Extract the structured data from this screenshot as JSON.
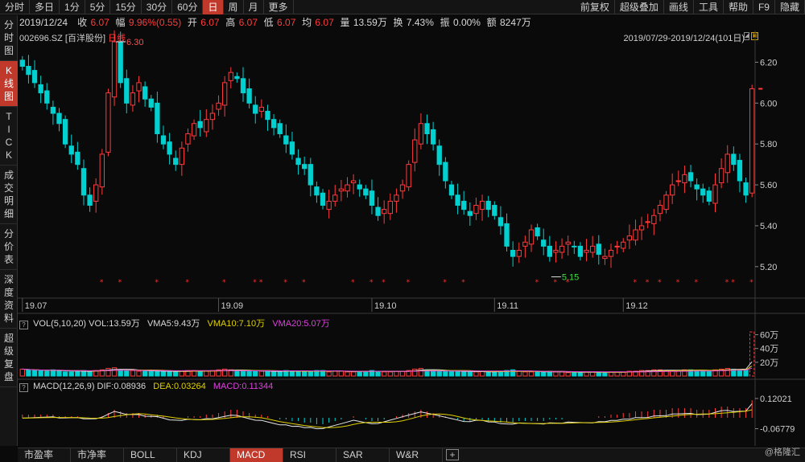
{
  "toolbar": {
    "left": [
      "分时",
      "多日",
      "1分",
      "5分",
      "15分",
      "30分",
      "60分",
      "日",
      "周",
      "月",
      "更多"
    ],
    "active": "日",
    "right": [
      "前复权",
      "超级叠加",
      "画线",
      "工具",
      "帮助",
      "F9",
      "隐藏"
    ]
  },
  "quote": {
    "date": "2019/12/24",
    "close_label": "收",
    "close": "6.07",
    "change_label": "幅",
    "change": "9.96%(0.55)",
    "open_label": "开",
    "open": "6.07",
    "high_label": "高",
    "high": "6.07",
    "low_label": "低",
    "low": "6.07",
    "avg_label": "均",
    "avg": "6.07",
    "volume_label": "量",
    "volume": "13.59万",
    "turnover_label": "换",
    "turnover": "7.43%",
    "amplitude_label": "振",
    "amplitude": "0.00%",
    "amount_label": "额",
    "amount": "8247万"
  },
  "leftnav": [
    "分时图",
    "K线图",
    "TICK",
    "成交明细",
    "分价表",
    "深度资料",
    "超级复盘"
  ],
  "leftnav_active": "K线图",
  "stock": {
    "code": "002696.SZ",
    "name": "[百洋股份]",
    "period": "日线"
  },
  "date_range": "2019/07/29-2019/12/24(101日)",
  "volume_indicator": {
    "name": "VOL(5,10,20)",
    "vol": "VOL:13.59万",
    "vma5": "VMA5:9.43万",
    "vma10": "VMA10:7.10万",
    "vma20": "VMA20:5.07万"
  },
  "macd_indicator": {
    "name": "MACD(12,26,9)",
    "dif": "DIF:0.08936",
    "dea": "DEA:0.03264",
    "macd": "MACD:0.11344"
  },
  "bottom_tabs": [
    "市盈率",
    "市净率",
    "BOLL",
    "KDJ",
    "MACD",
    "RSI",
    "SAR",
    "W&R"
  ],
  "bottom_active": "MACD",
  "watermark": "@格隆汇",
  "colors": {
    "up": "#ff3b3b",
    "down": "#00d0d0",
    "accent": "#c0392b",
    "vma10": "#e0d000",
    "vma20": "#e040e0"
  },
  "chart_data": [
    {
      "type": "candlestick",
      "title": "002696.SZ [百洋股份] 日线",
      "ylim": [
        5.05,
        6.3
      ],
      "y_ticks": [
        "6.20",
        "6.00",
        "5.80",
        "5.60",
        "5.40",
        "5.20"
      ],
      "y_tick_values": [
        6.2,
        6.0,
        5.8,
        5.6,
        5.4,
        5.2
      ],
      "x_ticks": [
        "19.07",
        "19.09",
        "19.10",
        "19.11",
        "19.12"
      ],
      "x_tick_index": [
        0,
        32,
        57,
        77,
        98
      ],
      "annotations": [
        {
          "label": "6.30",
          "value": 6.3,
          "index": 15
        },
        {
          "label": "5.15",
          "value": 5.15,
          "index": 86
        }
      ],
      "n": 120,
      "close": [
        6.18,
        6.14,
        6.1,
        6.05,
        6.0,
        5.95,
        5.9,
        5.8,
        5.75,
        5.7,
        5.55,
        5.5,
        5.6,
        5.75,
        6.05,
        6.3,
        6.1,
        6.0,
        6.05,
        6.1,
        6.02,
        5.98,
        5.85,
        5.8,
        5.75,
        5.7,
        5.78,
        5.85,
        5.9,
        5.88,
        5.92,
        5.95,
        6.0,
        6.1,
        6.15,
        6.12,
        6.05,
        6.0,
        5.95,
        5.98,
        5.92,
        5.88,
        5.85,
        5.8,
        5.75,
        5.7,
        5.68,
        5.6,
        5.55,
        5.5,
        5.52,
        5.55,
        5.58,
        5.6,
        5.62,
        5.58,
        5.55,
        5.5,
        5.45,
        5.48,
        5.52,
        5.55,
        5.6,
        5.7,
        5.82,
        5.9,
        5.85,
        5.8,
        5.7,
        5.62,
        5.55,
        5.5,
        5.48,
        5.45,
        5.5,
        5.52,
        5.48,
        5.45,
        5.4,
        5.3,
        5.25,
        5.28,
        5.32,
        5.38,
        5.35,
        5.3,
        5.25,
        5.28,
        5.3,
        5.32,
        5.3,
        5.25,
        5.28,
        5.3,
        5.26,
        5.25,
        5.28,
        5.3,
        5.32,
        5.35,
        5.38,
        5.4,
        5.42,
        5.45,
        5.5,
        5.55,
        5.6,
        5.62,
        5.65,
        5.62,
        5.58,
        5.55,
        5.52,
        5.6,
        5.68,
        5.75,
        5.7,
        5.62,
        5.55,
        6.07
      ],
      "volume_scale_ticks": [
        "60万",
        "40万",
        "20万"
      ],
      "volume_ylim": [
        0,
        70
      ],
      "volume": [
        10,
        9,
        8,
        8,
        7,
        9,
        8,
        6,
        6,
        7,
        8,
        7,
        8,
        9,
        11,
        12,
        9,
        8,
        8,
        7,
        7,
        8,
        7,
        6,
        7,
        6,
        7,
        8,
        8,
        7,
        7,
        8,
        9,
        10,
        9,
        8,
        8,
        7,
        7,
        7,
        7,
        6,
        7,
        8,
        7,
        7,
        6,
        7,
        8,
        8,
        6,
        7,
        7,
        6,
        6,
        7,
        7,
        8,
        7,
        6,
        6,
        7,
        7,
        8,
        10,
        11,
        9,
        8,
        7,
        7,
        7,
        7,
        6,
        6,
        6,
        7,
        6,
        6,
        7,
        8,
        9,
        7,
        6,
        6,
        6,
        6,
        7,
        6,
        6,
        5,
        5,
        6,
        6,
        6,
        5,
        5,
        6,
        6,
        6,
        7,
        7,
        8,
        8,
        9,
        9,
        8,
        8,
        8,
        9,
        9,
        8,
        8,
        7,
        9,
        10,
        11,
        10,
        9,
        10,
        64
      ],
      "macd_ticks": [
        "0.12021",
        "-0.06779"
      ],
      "macd_ylim": [
        -0.1,
        0.15
      ],
      "macd_hist": [
        0.02,
        0.02,
        0.02,
        0.02,
        0.02,
        0.02,
        0.01,
        0.01,
        0.01,
        0.01,
        0.0,
        0.0,
        0.0,
        0.01,
        0.03,
        0.05,
        0.04,
        0.03,
        0.03,
        0.03,
        0.02,
        0.02,
        0.02,
        0.01,
        0.0,
        0.0,
        0.0,
        0.01,
        0.01,
        0.01,
        0.02,
        0.02,
        0.03,
        0.04,
        0.05,
        0.05,
        0.04,
        0.03,
        0.02,
        0.02,
        0.01,
        0.0,
        -0.01,
        -0.01,
        -0.02,
        -0.02,
        -0.03,
        -0.03,
        -0.04,
        -0.04,
        -0.03,
        -0.02,
        -0.01,
        0.0,
        0.01,
        0.0,
        -0.01,
        -0.02,
        -0.02,
        -0.01,
        0.0,
        0.01,
        0.02,
        0.03,
        0.04,
        0.05,
        0.04,
        0.03,
        0.02,
        0.01,
        0.0,
        -0.01,
        -0.02,
        -0.02,
        -0.01,
        -0.01,
        -0.02,
        -0.02,
        -0.03,
        -0.03,
        -0.03,
        -0.02,
        -0.02,
        -0.02,
        -0.02,
        -0.02,
        -0.01,
        -0.01,
        -0.01,
        0.0,
        0.0,
        0.0,
        0.0,
        0.0,
        0.01,
        0.01,
        0.02,
        0.02,
        0.03,
        0.03,
        0.04,
        0.04,
        0.04,
        0.05,
        0.05,
        0.05,
        0.06,
        0.06,
        0.06,
        0.06,
        0.05,
        0.05,
        0.05,
        0.06,
        0.07,
        0.07,
        0.06,
        0.06,
        0.06,
        0.11
      ]
    }
  ]
}
